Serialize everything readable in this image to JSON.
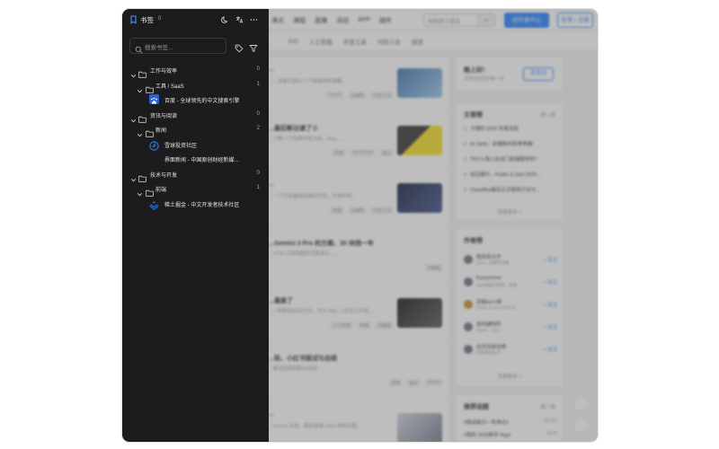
{
  "background": {
    "nav": [
      "沸点",
      "课程",
      "直播",
      "活动",
      "APP",
      "插件"
    ],
    "search_placeholder": "探索稀土掘金",
    "create_button": "创作者中心",
    "login_button": "登录 | 注册",
    "tabs": [
      "iOS",
      "人工智能",
      "开发工具",
      "代码人生",
      "阅读"
    ],
    "articles": [
      {
        "title": "…",
        "desc": "…，这篇文章从三个维度帮你理解…",
        "tags": [
          "Cursor",
          "AI编程",
          "开发工具"
        ]
      },
      {
        "title": "…最后断功课了😮",
        "desc": "…了解一个经典开发方向，Bug，…",
        "tags": [
          "前端",
          "JavaScript",
          "面试"
        ]
      },
      {
        "title": "…",
        "desc": "…一个开发基础设施的项目，开源中的…",
        "tags": [
          "前端",
          "AI编程",
          "开发工具"
        ]
      },
      {
        "title": "…Gemini 3 Pro 的方案，30 块钱一年",
        "desc": "…STBI 订阅流程的完整演示……",
        "tags": [
          "AI编程"
        ]
      },
      {
        "title": "…最美了",
        "desc": "…一种新的技术方向，作为 Mac 上的主力开发…",
        "tags": [
          "人工智能",
          "前端",
          "AI编程"
        ]
      },
      {
        "title": "…际，小红书面试与总结",
        "desc": "…面试流程回顾与总结",
        "tags": [
          "前端",
          "面试",
          "Github"
        ]
      },
      {
        "title": "…",
        "desc": "…Cursor 对话，都在处理 rules 等的问题…",
        "tags": [
          "前端",
          "AI编程",
          "开发工具"
        ]
      },
      {
        "title": "…，不是上班后还剩的，也不是下班做失…",
        "desc": "…一段职场路上思考的问题…",
        "tags": [
          "前端",
          "代码人生"
        ]
      },
      {
        "title": "…",
        "desc": "…今天这篇文章从主要分享大模型 API 的…",
        "tags": [
          "AI",
          "AI编程",
          "Cursor"
        ]
      }
    ],
    "greeting": {
      "title": "晚上好!",
      "sub": "点亮在社区的每一天",
      "button": "去签到"
    },
    "hot": {
      "title": "文章榜",
      "refresh": "换一换",
      "items": [
        "子弹的 2025 年度总结",
        "AI Skills：前端新的效率神器!",
        "为什么我入走出门前端程序员?",
        "血压飙升，Flutter & Dart 2025…",
        "ClawdBot最后正式使用方法与…"
      ],
      "more": "查看更多 >"
    },
    "authors": {
      "title": "作者榜",
      "items": [
        {
          "name": "程序员大宇",
          "desc": "Java，前端开发者",
          "follow": "+ 关注"
        },
        {
          "name": "ErpanOmer",
          "desc": "Web前端工程师，全栈",
          "follow": "+ 关注"
        },
        {
          "name": "恋猫de小郭",
          "desc": "Flutter & Dart GDE 谷…",
          "follow": "+ 关注"
        },
        {
          "name": "张风捷特烈",
          "desc": "Flutter、DW…",
          "follow": "+ 关注"
        },
        {
          "name": "也无风雨也晴",
          "desc": "作者等级标识",
          "follow": "+ 关注"
        }
      ],
      "more": "查看更多 >"
    },
    "topics": {
      "title": "推荐话题",
      "refresh": "换一换",
      "items": [
        {
          "name": "#挑战每日一条沸点#",
          "count": "22.6m"
        },
        {
          "name": "#我的 2026新年 flag#",
          "count": "257k"
        }
      ]
    }
  },
  "panel": {
    "title": "书签",
    "count": "0",
    "search_placeholder": "搜索书签...",
    "tree": [
      {
        "type": "folder",
        "level": 0,
        "label": "工作与效率",
        "count": "0"
      },
      {
        "type": "folder",
        "level": 1,
        "label": "工具 / SaaS",
        "count": "1"
      },
      {
        "type": "bookmark",
        "level": 2,
        "label": "百度 - 全球领先的中文搜索引擎",
        "favicon": "baidu"
      },
      {
        "type": "folder",
        "level": 0,
        "label": "资讯与阅读",
        "count": "0"
      },
      {
        "type": "folder",
        "level": 1,
        "label": "新闻",
        "count": "2"
      },
      {
        "type": "bookmark",
        "level": 2,
        "label": "雪球投资社区",
        "favicon": "xueqiu"
      },
      {
        "type": "bookmark",
        "level": 2,
        "label": "界面新闻 - 中国原创财经新媒…",
        "favicon": "none"
      },
      {
        "type": "folder",
        "level": 0,
        "label": "技术与开发",
        "count": "0"
      },
      {
        "type": "folder",
        "level": 1,
        "label": "前端",
        "count": "1"
      },
      {
        "type": "bookmark",
        "level": 2,
        "label": "稀土掘金 - 中文开发者技术社区",
        "favicon": "juejin"
      }
    ]
  },
  "colors": {
    "panel_bg": "#1c1c1e",
    "accent": "#1e80ff",
    "baidu_favicon": "#2f62d8",
    "xueqiu_favicon": "#2c77e6",
    "juejin_favicon": "#1e80ff"
  }
}
